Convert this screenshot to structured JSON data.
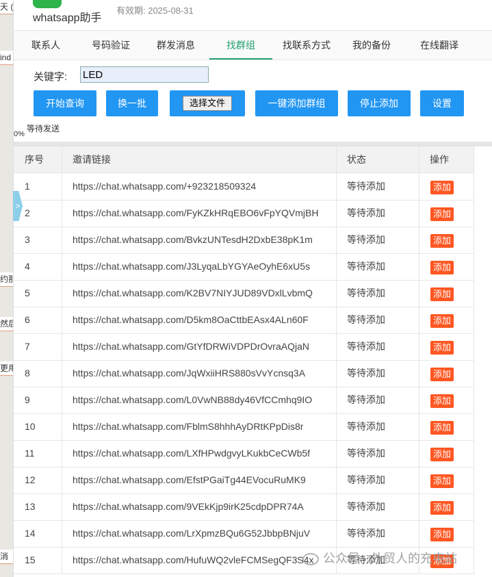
{
  "background": {
    "fragments": [
      "天 (",
      "ind",
      "约那",
      "然后",
      "更用",
      "消"
    ]
  },
  "header": {
    "app_name": "whatsapp助手",
    "validity": "有效期: 2025-08-31"
  },
  "tabs": [
    {
      "label": "联系人",
      "active": false
    },
    {
      "label": "号码验证",
      "active": false
    },
    {
      "label": "群发消息",
      "active": false
    },
    {
      "label": "找群组",
      "active": true
    },
    {
      "label": "找联系方式",
      "active": false
    },
    {
      "label": "我的备份",
      "active": false
    },
    {
      "label": "在线翻译",
      "active": false
    }
  ],
  "search": {
    "label": "关键字:",
    "value": "LED"
  },
  "toolbar": {
    "start": "开始查询",
    "next_batch": "换一批",
    "choose_file": "选择文件",
    "add_all": "一键添加群组",
    "stop": "停止添加",
    "settings": "设置"
  },
  "status": {
    "waiting": "等待发送",
    "progress": "0%"
  },
  "collapse_glyph": ">",
  "table": {
    "headers": [
      "序号",
      "邀请链接",
      "状态",
      "操作"
    ],
    "rows": [
      {
        "no": "1",
        "link": "https://chat.whatsapp.com/+923218509324",
        "status": "等待添加",
        "action": "添加"
      },
      {
        "no": "2",
        "link": "https://chat.whatsapp.com/FyKZkHRqEBO6vFpYQVmjBH",
        "status": "等待添加",
        "action": "添加"
      },
      {
        "no": "3",
        "link": "https://chat.whatsapp.com/BvkzUNTesdH2DxbE38pK1m",
        "status": "等待添加",
        "action": "添加"
      },
      {
        "no": "4",
        "link": "https://chat.whatsapp.com/J3LyqaLbYGYAeOyhE6xU5s",
        "status": "等待添加",
        "action": "添加"
      },
      {
        "no": "5",
        "link": "https://chat.whatsapp.com/K2BV7NIYJUD89VDxlLvbmQ",
        "status": "等待添加",
        "action": "添加"
      },
      {
        "no": "6",
        "link": "https://chat.whatsapp.com/D5km8OaCttbEAsx4ALn60F",
        "status": "等待添加",
        "action": "添加"
      },
      {
        "no": "7",
        "link": "https://chat.whatsapp.com/GtYfDRWiVDPDrOvraAQjaN",
        "status": "等待添加",
        "action": "添加"
      },
      {
        "no": "8",
        "link": "https://chat.whatsapp.com/JqWxiiHRS880sVvYcnsq3A",
        "status": "等待添加",
        "action": "添加"
      },
      {
        "no": "9",
        "link": "https://chat.whatsapp.com/L0VwNB88dy46VfCCmhq9IO",
        "status": "等待添加",
        "action": "添加"
      },
      {
        "no": "10",
        "link": "https://chat.whatsapp.com/FblmS8hhhAyDRtKPpDis8r",
        "status": "等待添加",
        "action": "添加"
      },
      {
        "no": "11",
        "link": "https://chat.whatsapp.com/LXfHPwdgvyLKukbCeCWb5f",
        "status": "等待添加",
        "action": "添加"
      },
      {
        "no": "12",
        "link": "https://chat.whatsapp.com/EfstPGaiTg44EVocuRuMK9",
        "status": "等待添加",
        "action": "添加"
      },
      {
        "no": "13",
        "link": "https://chat.whatsapp.com/9VEkKjp9irK25cdpDPR74A",
        "status": "等待添加",
        "action": "添加"
      },
      {
        "no": "14",
        "link": "https://chat.whatsapp.com/LrXpmzBQu6G52JbbpBNjuV",
        "status": "等待添加",
        "action": "添加"
      },
      {
        "no": "15",
        "link": "https://chat.whatsapp.com/HufuWQ2vleFCMSegQF3S4x",
        "status": "等待添加",
        "action": "添加"
      }
    ]
  },
  "watermark": "公众号 · 外贸人的充电站",
  "colors": {
    "primary": "#2196f3",
    "add": "#ff5722",
    "tab_active": "#22a06b",
    "logo": "#2cb34a"
  }
}
